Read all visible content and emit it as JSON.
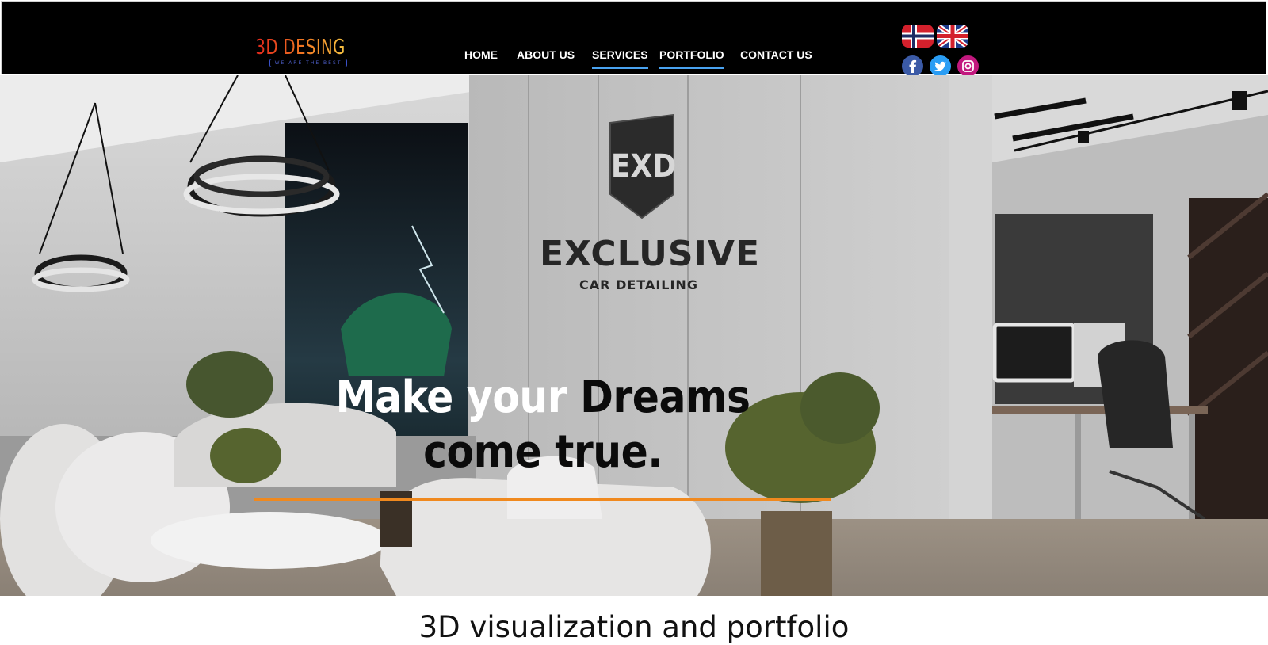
{
  "header": {
    "logo": {
      "main": "3D DESING",
      "tagline": "WE ARE THE BEST"
    },
    "nav": [
      {
        "label": "HOME",
        "active": false
      },
      {
        "label": "ABOUT US",
        "active": false
      },
      {
        "label": "SERVICES",
        "active": true
      },
      {
        "label": "PORTFOLIO",
        "active": true
      },
      {
        "label": "CONTACT US",
        "active": false
      }
    ],
    "languages": [
      "norway-flag-icon",
      "uk-flag-icon"
    ],
    "social": [
      "facebook-icon",
      "twitter-icon",
      "instagram-icon"
    ]
  },
  "hero": {
    "headline": {
      "line1_white": "Make your ",
      "line1_dark": "Dreams",
      "line2": "come true."
    },
    "sign": {
      "monogram": "EXD",
      "brand": "EXCLUSIVE",
      "sub": "CAR DETAILING"
    },
    "accent_color": "#f0891e"
  },
  "section": {
    "title": "3D visualization and portfolio"
  },
  "colors": {
    "header_bg": "#000000",
    "nav_underline": "#4aa3f0",
    "accent": "#f0891e"
  }
}
